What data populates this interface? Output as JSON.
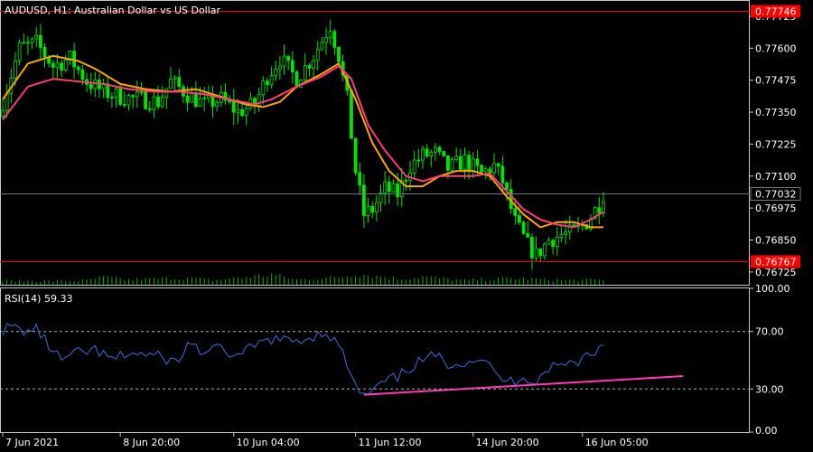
{
  "chart": {
    "symbol_label": "AUDUSD, H1:  Australian Dollar vs US Dollar",
    "rsi_label": "RSI(14) 59.33"
  },
  "colors": {
    "background": "#000000",
    "frame": "#c8c8c8",
    "candle": "#00e600",
    "ma_fast": "#ffa500",
    "ma_slow": "#ff3c78",
    "hline": "#ff0000",
    "current_line": "#6e7a82",
    "rsi_line": "#3f6fe0",
    "trendline": "#ff3cb4",
    "level_dash": "#b4b4b4",
    "volume": "#00b400"
  },
  "chart_data": [
    {
      "type": "candlestick",
      "name": "AUDUSD H1",
      "ylim": [
        0.76675,
        0.77785
      ],
      "y_ticks": [
        "0.77725",
        "0.77600",
        "0.77475",
        "0.77350",
        "0.77225",
        "0.77100",
        "0.76975",
        "0.76850",
        "0.76725"
      ],
      "y_tick_values": [
        0.77725,
        0.776,
        0.77475,
        0.7735,
        0.77225,
        0.771,
        0.76975,
        0.7685,
        0.76725
      ],
      "x_labels": [
        "7 Jun 2021",
        "8 Jun 20:00",
        "10 Jun 04:00",
        "11 Jun 12:00",
        "14 Jun 20:00",
        "16 Jun 05:00"
      ],
      "x_label_positions": [
        0,
        28,
        55,
        84,
        112,
        138
      ],
      "candle_count": 144,
      "close_path": [
        [
          0,
          0.7739
        ],
        [
          4,
          0.776
        ],
        [
          8,
          0.7762
        ],
        [
          12,
          0.7753
        ],
        [
          16,
          0.7756
        ],
        [
          20,
          0.7747
        ],
        [
          24,
          0.7743
        ],
        [
          28,
          0.7741
        ],
        [
          33,
          0.774
        ],
        [
          37,
          0.7739
        ],
        [
          40,
          0.7747
        ],
        [
          44,
          0.7742
        ],
        [
          48,
          0.7738
        ],
        [
          52,
          0.774
        ],
        [
          56,
          0.7735
        ],
        [
          60,
          0.7738
        ],
        [
          63,
          0.7749
        ],
        [
          66,
          0.7756
        ],
        [
          70,
          0.7748
        ],
        [
          74,
          0.7757
        ],
        [
          78,
          0.7769
        ],
        [
          80,
          0.7757
        ],
        [
          82,
          0.774
        ],
        [
          84,
          0.7712
        ],
        [
          86,
          0.7695
        ],
        [
          88,
          0.7697
        ],
        [
          91,
          0.7705
        ],
        [
          94,
          0.7703
        ],
        [
          97,
          0.7714
        ],
        [
          100,
          0.7718
        ],
        [
          103,
          0.7719
        ],
        [
          106,
          0.7713
        ],
        [
          110,
          0.7716
        ],
        [
          114,
          0.7711
        ],
        [
          117,
          0.7714
        ],
        [
          119,
          0.7708
        ],
        [
          122,
          0.7692
        ],
        [
          125,
          0.7683
        ],
        [
          127,
          0.7679
        ],
        [
          130,
          0.7685
        ],
        [
          133,
          0.7687
        ],
        [
          136,
          0.7688
        ],
        [
          139,
          0.7692
        ],
        [
          142,
          0.7699
        ],
        [
          143,
          0.77032
        ]
      ],
      "volume_path": [
        [
          0,
          0.55
        ],
        [
          10,
          0.5
        ],
        [
          20,
          0.6
        ],
        [
          24,
          1.0
        ],
        [
          30,
          0.7
        ],
        [
          44,
          0.95
        ],
        [
          50,
          0.6
        ],
        [
          64,
          1.4
        ],
        [
          70,
          0.7
        ],
        [
          80,
          1.0
        ],
        [
          84,
          1.5
        ],
        [
          95,
          0.8
        ],
        [
          100,
          1.1
        ],
        [
          110,
          0.6
        ],
        [
          120,
          0.9
        ],
        [
          126,
          0.8
        ],
        [
          135,
          0.6
        ],
        [
          143,
          0.7
        ]
      ],
      "hlines": [
        {
          "price": 0.77746,
          "label": "0.77746",
          "style": "red"
        },
        {
          "price": 0.76767,
          "label": "0.76767",
          "style": "red"
        },
        {
          "price": 0.77032,
          "label": "0.77032",
          "style": "current"
        }
      ],
      "ma_fast_path": [
        [
          0,
          0.774
        ],
        [
          6,
          0.7754
        ],
        [
          12,
          0.7757
        ],
        [
          18,
          0.7755
        ],
        [
          22,
          0.7752
        ],
        [
          28,
          0.7746
        ],
        [
          34,
          0.7744
        ],
        [
          40,
          0.7743
        ],
        [
          46,
          0.7744
        ],
        [
          52,
          0.7741
        ],
        [
          58,
          0.7738
        ],
        [
          62,
          0.7737
        ],
        [
          66,
          0.7739
        ],
        [
          70,
          0.7745
        ],
        [
          76,
          0.775
        ],
        [
          80,
          0.7754
        ],
        [
          84,
          0.774
        ],
        [
          88,
          0.7723
        ],
        [
          92,
          0.7712
        ],
        [
          96,
          0.7706
        ],
        [
          100,
          0.7706
        ],
        [
          104,
          0.771
        ],
        [
          108,
          0.7712
        ],
        [
          112,
          0.7712
        ],
        [
          116,
          0.771
        ],
        [
          120,
          0.7702
        ],
        [
          124,
          0.7695
        ],
        [
          128,
          0.769
        ],
        [
          132,
          0.7692
        ],
        [
          136,
          0.7692
        ],
        [
          140,
          0.769
        ],
        [
          143,
          0.769
        ]
      ],
      "ma_slow_path": [
        [
          0,
          0.7732
        ],
        [
          6,
          0.7745
        ],
        [
          12,
          0.7748
        ],
        [
          18,
          0.7747
        ],
        [
          24,
          0.7746
        ],
        [
          30,
          0.7744
        ],
        [
          36,
          0.7743
        ],
        [
          42,
          0.7743
        ],
        [
          48,
          0.7742
        ],
        [
          54,
          0.774
        ],
        [
          60,
          0.7738
        ],
        [
          64,
          0.774
        ],
        [
          70,
          0.7745
        ],
        [
          76,
          0.7749
        ],
        [
          80,
          0.7753
        ],
        [
          83,
          0.7748
        ],
        [
          87,
          0.773
        ],
        [
          91,
          0.772
        ],
        [
          96,
          0.771
        ],
        [
          100,
          0.7708
        ],
        [
          104,
          0.771
        ],
        [
          108,
          0.771
        ],
        [
          112,
          0.771
        ],
        [
          116,
          0.7711
        ],
        [
          120,
          0.7704
        ],
        [
          124,
          0.7697
        ],
        [
          128,
          0.7693
        ],
        [
          132,
          0.7691
        ],
        [
          136,
          0.769
        ],
        [
          140,
          0.7693
        ],
        [
          143,
          0.7696
        ]
      ]
    },
    {
      "type": "line",
      "name": "RSI(14)",
      "ylim": [
        0,
        100
      ],
      "y_ticks": [
        "100.00",
        "70.00",
        "30.00",
        "0.00"
      ],
      "y_tick_values": [
        100,
        70,
        30,
        0
      ],
      "levels": [
        70,
        30
      ],
      "rsi_path": [
        [
          0,
          71
        ],
        [
          2,
          73
        ],
        [
          6,
          70
        ],
        [
          8,
          72
        ],
        [
          11,
          60
        ],
        [
          14,
          50
        ],
        [
          18,
          55
        ],
        [
          22,
          57
        ],
        [
          26,
          50
        ],
        [
          30,
          55
        ],
        [
          34,
          54
        ],
        [
          38,
          52
        ],
        [
          42,
          48
        ],
        [
          44,
          63
        ],
        [
          48,
          55
        ],
        [
          52,
          58
        ],
        [
          56,
          52
        ],
        [
          60,
          60
        ],
        [
          64,
          65
        ],
        [
          68,
          63
        ],
        [
          72,
          65
        ],
        [
          77,
          70
        ],
        [
          80,
          60
        ],
        [
          82,
          47
        ],
        [
          84,
          31
        ],
        [
          86,
          25
        ],
        [
          88,
          28
        ],
        [
          91,
          35
        ],
        [
          94,
          38
        ],
        [
          97,
          45
        ],
        [
          100,
          50
        ],
        [
          103,
          53
        ],
        [
          106,
          48
        ],
        [
          110,
          49
        ],
        [
          114,
          52
        ],
        [
          118,
          38
        ],
        [
          121,
          35
        ],
        [
          124,
          39
        ],
        [
          127,
          35
        ],
        [
          130,
          45
        ],
        [
          134,
          47
        ],
        [
          137,
          50
        ],
        [
          140,
          55
        ],
        [
          143,
          60
        ]
      ],
      "trendline": {
        "from": [
          86,
          26
        ],
        "to": [
          162,
          39
        ]
      }
    }
  ]
}
